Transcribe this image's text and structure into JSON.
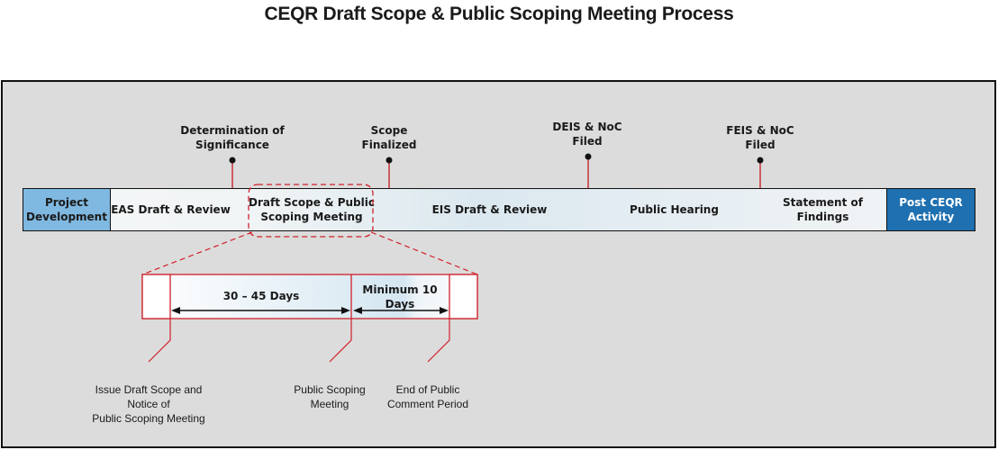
{
  "title": "CEQR Draft Scope & Public Scoping  Meeting Process",
  "timeline": {
    "segments": [
      {
        "label_line1": "Project",
        "label_line2": "Development",
        "color": "#7fb8e0"
      },
      {
        "label": "EAS Draft & Review"
      },
      {
        "label_line1": "Draft Scope & Public",
        "label_line2": "Scoping  Meeting",
        "highlighted": true
      },
      {
        "label": "EIS Draft & Review"
      },
      {
        "label": "Public Hearing"
      },
      {
        "label_line1": "Statement of",
        "label_line2": "Findings"
      },
      {
        "label_line1": "Post CEQR",
        "label_line2": "Activity",
        "color": "#1f70b0"
      }
    ],
    "milestones": [
      {
        "line1": "Determination of",
        "line2": "Significance"
      },
      {
        "line1": "Scope",
        "line2": "Finalized"
      },
      {
        "line1": "DEIS & NoC",
        "line2": "Filed"
      },
      {
        "line1": "FEIS & NoC",
        "line2": "Filed"
      }
    ]
  },
  "detail": {
    "periods": [
      {
        "label": "30 – 45 Days"
      },
      {
        "label_line1": "Minimum 10",
        "label_line2": "Days"
      }
    ],
    "events": [
      {
        "line1": "Issue Draft Scope and",
        "line2": "Notice of",
        "line3": "Public Scoping Meeting"
      },
      {
        "line1": "Public Scoping",
        "line2": "Meeting"
      },
      {
        "line1": "End of Public",
        "line2": "Comment Period"
      }
    ]
  },
  "colors": {
    "accent_red": "#d0202a",
    "project_dev_blue": "#7fb8e0",
    "post_ceqr_blue": "#1f70b0",
    "panel_gray": "#dcdcdc"
  }
}
